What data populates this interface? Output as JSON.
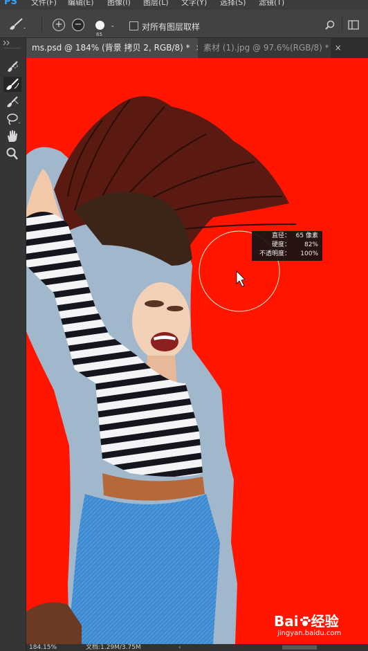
{
  "app": {
    "logo": "PS"
  },
  "menu": [
    "文件(F)",
    "编辑(E)",
    "图像(I)",
    "图层(L)",
    "文字(Y)",
    "选择(S)",
    "滤镜(T)"
  ],
  "options": {
    "brush_size": "65",
    "sample_all_layers_label": "对所有图层取样",
    "sample_all_layers_checked": false
  },
  "tabs": [
    {
      "label": "ms.psd @ 184% (背景 拷贝 2, RGB/8) *",
      "close": "×",
      "active": true
    },
    {
      "label": "素材 (1).jpg @ 97.6%(RGB/8) *",
      "close": "×",
      "active": false
    }
  ],
  "tooltip": {
    "diameter_label": "直径：",
    "diameter_value": "65 像素",
    "hardness_label": "硬度：",
    "hardness_value": "82%",
    "opacity_label": "不透明度：",
    "opacity_value": "100%"
  },
  "status": {
    "zoom": "184.15%",
    "doc": "文档:1.29M/3.75M"
  },
  "watermark": {
    "brand": "Bai",
    "brand_tail": "经验",
    "url": "jingyan.baidu.com"
  },
  "colors": {
    "mask_overlay": "#ff1500",
    "sky": "#9fb6cc",
    "ui_dark": "#2b2b2b",
    "tab_active": "#4a4a4a"
  }
}
